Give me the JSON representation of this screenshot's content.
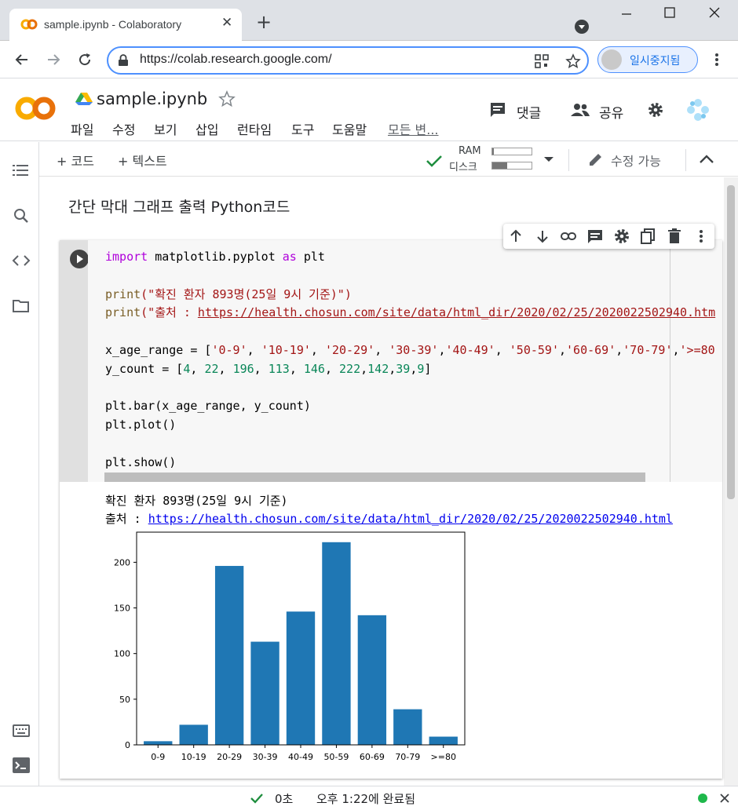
{
  "browser": {
    "tab_title": "sample.ipynb - Colaboratory",
    "tab_close": "✕",
    "new_tab": "+",
    "url": "https://colab.research.google.com/",
    "profile_label": "일시중지됨"
  },
  "colab": {
    "logo": "CO",
    "notebook_title": "sample.ipynb",
    "comment_label": "댓글",
    "share_label": "공유",
    "menu": [
      "파일",
      "수정",
      "보기",
      "삽입",
      "런타임",
      "도구",
      "도움말",
      "모든 변..."
    ]
  },
  "toolbar": {
    "add_code": "+ 코드",
    "add_text": "+ 텍스트",
    "ram_label": "RAM",
    "disk_label": "디스크",
    "edit_mode": "수정 가능",
    "ram_usage": 0.04,
    "disk_usage": 0.38
  },
  "text_cell": "간단 막대 그래프 출력 Python코드",
  "code_lines": [
    [
      {
        "t": "import",
        "c": "kw"
      },
      {
        "t": " matplotlib.pyplot "
      },
      {
        "t": "as",
        "c": "kw"
      },
      {
        "t": " plt"
      }
    ],
    [],
    [
      {
        "t": "print",
        "c": "fn"
      },
      {
        "t": "(\"확진 환자 893명(25일 9시 기준)\")",
        "c": "st"
      }
    ],
    [
      {
        "t": "print",
        "c": "fn"
      },
      {
        "t": "(\"출처 : ",
        "c": "st"
      },
      {
        "t": "https://health.chosun.com/site/data/html_dir/2020/02/25/2020022502940.htm",
        "c": "st",
        "u": true
      }
    ],
    [],
    [
      {
        "t": "x_age_range = ["
      },
      {
        "t": "'0-9'",
        "c": "st"
      },
      {
        "t": ", "
      },
      {
        "t": "'10-19'",
        "c": "st"
      },
      {
        "t": ", "
      },
      {
        "t": "'20-29'",
        "c": "st"
      },
      {
        "t": ", "
      },
      {
        "t": "'30-39'",
        "c": "st"
      },
      {
        "t": ","
      },
      {
        "t": "'40-49'",
        "c": "st"
      },
      {
        "t": ", "
      },
      {
        "t": "'50-59'",
        "c": "st"
      },
      {
        "t": ","
      },
      {
        "t": "'60-69'",
        "c": "st"
      },
      {
        "t": ","
      },
      {
        "t": "'70-79'",
        "c": "st"
      },
      {
        "t": ","
      },
      {
        "t": "'>=80",
        "c": "st"
      }
    ],
    [
      {
        "t": "y_count = ["
      },
      {
        "t": "4",
        "c": "nm"
      },
      {
        "t": ", "
      },
      {
        "t": "22",
        "c": "nm"
      },
      {
        "t": ", "
      },
      {
        "t": "196",
        "c": "nm"
      },
      {
        "t": ", "
      },
      {
        "t": "113",
        "c": "nm"
      },
      {
        "t": ", "
      },
      {
        "t": "146",
        "c": "nm"
      },
      {
        "t": ", "
      },
      {
        "t": "222",
        "c": "nm"
      },
      {
        "t": ","
      },
      {
        "t": "142",
        "c": "nm"
      },
      {
        "t": ","
      },
      {
        "t": "39",
        "c": "nm"
      },
      {
        "t": ","
      },
      {
        "t": "9",
        "c": "nm"
      },
      {
        "t": "]"
      }
    ],
    [],
    [
      {
        "t": "plt.bar(x_age_range, y_count)"
      }
    ],
    [
      {
        "t": "plt.plot()"
      }
    ],
    [],
    [
      {
        "t": "plt.show()"
      }
    ]
  ],
  "output": {
    "line1": "확진 환자 893명(25일 9시 기준)",
    "line2_prefix": "출처 : ",
    "line2_link": "https://health.chosun.com/site/data/html_dir/2020/02/25/2020022502940.html"
  },
  "chart_data": {
    "type": "bar",
    "categories": [
      "0-9",
      "10-19",
      "20-29",
      "30-39",
      "40-49",
      "50-59",
      "60-69",
      "70-79",
      ">=80"
    ],
    "values": [
      4,
      22,
      196,
      113,
      146,
      222,
      142,
      39,
      9
    ],
    "ylim": [
      0,
      233
    ],
    "yticks": [
      0,
      50,
      100,
      150,
      200
    ],
    "color": "#1f77b4",
    "grid": false
  },
  "status": {
    "time": "0초",
    "completed": "오후 1:22에 완료됨"
  }
}
